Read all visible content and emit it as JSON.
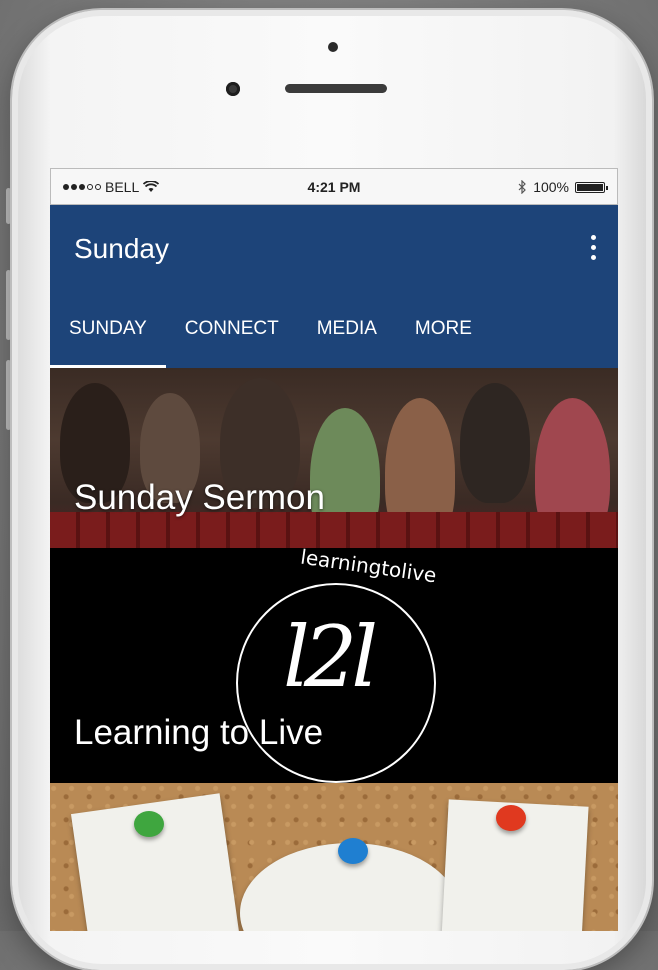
{
  "status_bar": {
    "carrier": "BELL",
    "time": "4:21 PM",
    "battery": "100%"
  },
  "app": {
    "title": "Sunday",
    "tabs": [
      {
        "label": "SUNDAY",
        "active": true
      },
      {
        "label": "CONNECT",
        "active": false
      },
      {
        "label": "MEDIA",
        "active": false
      },
      {
        "label": "MORE",
        "active": false
      }
    ],
    "accent": "#1d4479"
  },
  "cards": [
    {
      "label": "Sunday Sermon"
    },
    {
      "label": "Learning to Live",
      "logo_arc_text": "learningtolive",
      "logo_monogram": "l2l"
    },
    {
      "label": ""
    }
  ],
  "icons": {
    "wifi": "wifi-icon",
    "bluetooth": "bluetooth-icon",
    "battery": "battery-icon",
    "menu": "more-vert-icon"
  }
}
